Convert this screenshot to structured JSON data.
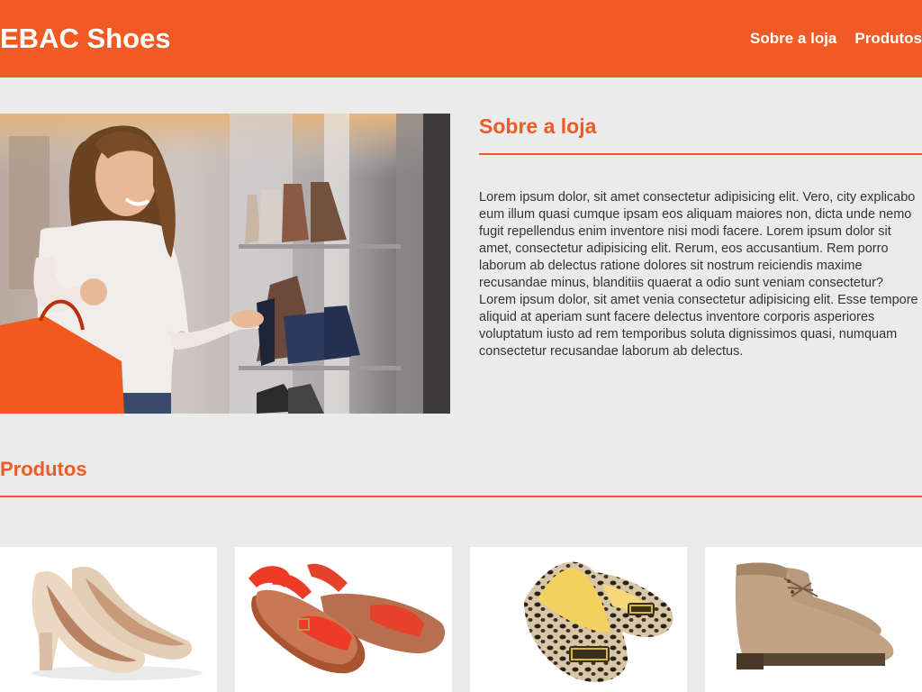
{
  "header": {
    "logo": "EBAC Shoes",
    "nav": [
      "Sobre a loja",
      "Produtos"
    ]
  },
  "about": {
    "title": "Sobre a loja",
    "text": "Lorem ipsum dolor, sit amet consectetur adipisicing elit. Vero, city explicabo eum illum quasi cumque ipsam eos aliquam maiores non, dicta unde nemo fugit repellendus enim inventore nisi modi facere. Lorem ipsum dolor sit amet, consectetur adipisicing elit. Rerum, eos accusantium. Rem porro laborum ab delectus ratione dolores sit nostrum reiciendis maxime recusandae minus, blanditiis quaerat a odio sunt veniam consectetur? Lorem ipsum dolor, sit amet venia consectetur adipisicing elit. Esse tempore aliquid at aperiam sunt facere delectus inventore corporis asperiores voluptatum iusto ad rem temporibus soluta dignissimos quasi, numquam consectetur recusandae laborum ab delectus."
  },
  "products": {
    "title": "Produtos",
    "items": [
      {
        "icon": "nude-peep-toe-heels-image"
      },
      {
        "icon": "red-strap-sandals-image"
      },
      {
        "icon": "leopard-print-flats-image"
      },
      {
        "icon": "beige-ankle-boots-image"
      }
    ]
  },
  "colors": {
    "accent": "#f15a24",
    "background": "#ebebeb",
    "text": "#333333"
  }
}
